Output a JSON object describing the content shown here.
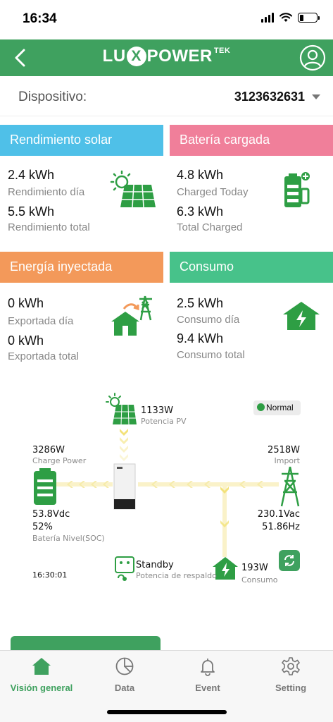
{
  "status": {
    "time": "16:34"
  },
  "header": {
    "logo_lu": "LU",
    "logo_x": "X",
    "logo_power": "POWER",
    "logo_tek": "TEK"
  },
  "device": {
    "label": "Dispositivo:",
    "value": "3123632631"
  },
  "cards": {
    "solar": {
      "title": "Rendimiento solar",
      "color": "#4fc0e8",
      "today_value": "2.4 kWh",
      "today_label": "Rendimiento día",
      "total_value": "5.5 kWh",
      "total_label": "Rendimiento total"
    },
    "battery": {
      "title": "Batería cargada",
      "color": "#f07f9a",
      "today_value": "4.8 kWh",
      "today_label": "Charged Today",
      "total_value": "6.3 kWh",
      "total_label": "Total Charged"
    },
    "export": {
      "title": "Energía inyectada",
      "color": "#f3995a",
      "today_value": "0 kWh",
      "today_label": "Exportada día",
      "total_value": "0 kWh",
      "total_label": "Exportada total"
    },
    "consumption": {
      "title": "Consumo",
      "color": "#47c28a",
      "today_value": "2.5 kWh",
      "today_label": "Consumo día",
      "total_value": "9.4 kWh",
      "total_label": "Consumo total"
    }
  },
  "flow": {
    "pv_power": "1133W",
    "pv_label": "Potencia PV",
    "status": "Normal",
    "charge_power": "3286W",
    "charge_label": "Charge Power",
    "import_power": "2518W",
    "import_label": "Import",
    "battery_voltage": "53.8Vdc",
    "battery_soc": "52%",
    "battery_label": "Batería Nivel(SOC)",
    "grid_voltage": "230.1Vac",
    "grid_freq": "51.86Hz",
    "backup_status": "Standby",
    "backup_label": "Potencia de respaldo",
    "consumption_power": "193W",
    "consumption_label": "Consumo",
    "time": "16:30:01"
  },
  "nav": {
    "overview": "Visión general",
    "data": "Data",
    "event": "Event",
    "setting": "Setting"
  },
  "colors": {
    "primary": "#3fa15f",
    "icon_green": "#2e9e44",
    "arrow_yellow": "#f3e27a"
  }
}
